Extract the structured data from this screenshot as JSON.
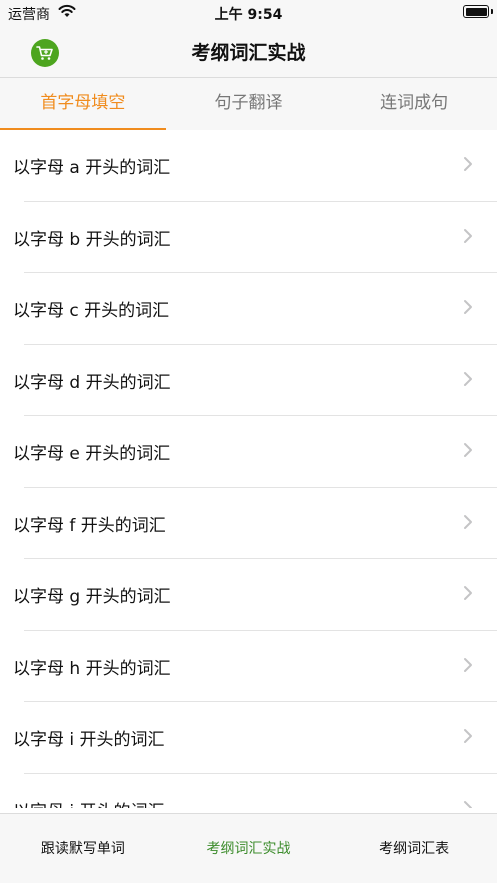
{
  "status_bar": {
    "carrier": "运营商",
    "time": "上午 9:54"
  },
  "nav": {
    "title": "考纲词汇实战",
    "cart_icon": "cart-icon"
  },
  "tabs": [
    {
      "label": "首字母填空",
      "active": true
    },
    {
      "label": "句子翻译",
      "active": false
    },
    {
      "label": "连词成句",
      "active": false
    }
  ],
  "list": {
    "items": [
      {
        "label": "以字母 a 开头的词汇"
      },
      {
        "label": "以字母 b 开头的词汇"
      },
      {
        "label": "以字母 c 开头的词汇"
      },
      {
        "label": "以字母 d 开头的词汇"
      },
      {
        "label": "以字母 e 开头的词汇"
      },
      {
        "label": "以字母 f 开头的词汇"
      },
      {
        "label": "以字母 g 开头的词汇"
      },
      {
        "label": "以字母 h 开头的词汇"
      },
      {
        "label": "以字母 i 开头的词汇"
      },
      {
        "label": "以字母 j 开头的词汇"
      }
    ]
  },
  "tab_bar": [
    {
      "label": "跟读默写单词",
      "active": false
    },
    {
      "label": "考纲词汇实战",
      "active": true
    },
    {
      "label": "考纲词汇表",
      "active": false
    }
  ],
  "colors": {
    "accent": "#f08c1e",
    "brand_green": "#4da51f",
    "active_tab_bar": "#3c8c2c"
  }
}
